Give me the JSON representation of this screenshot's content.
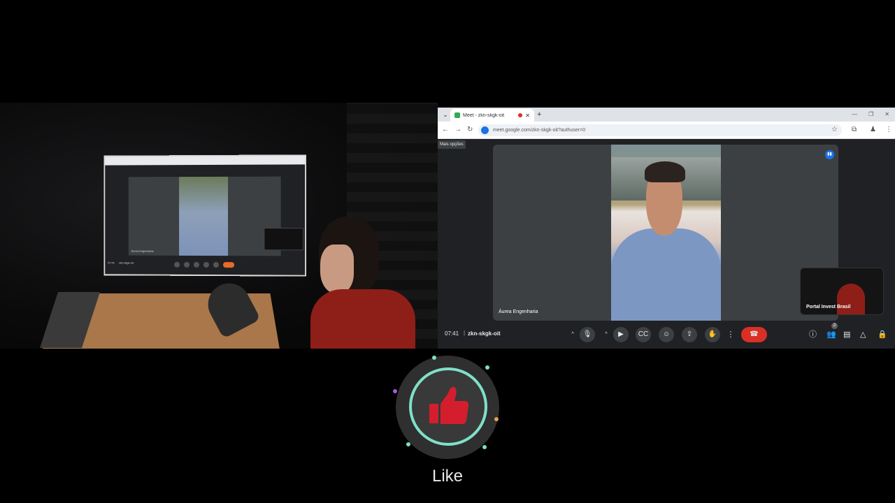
{
  "studio_monitor": {
    "screen_clock": "07:41",
    "screen_code": "zkn-skgk-oit",
    "screen_name": "Áurea Engenharia"
  },
  "browser": {
    "tab_title": "Meet - zkn-skgk-oit",
    "new_tab": "+",
    "address_url": "meet.google.com/zkn-skgk-oit?authuser=0"
  },
  "meet": {
    "more_options": "Mais opções",
    "main_participant": "Áurea Engenharia",
    "self_participant": "Portal Invest Brasil",
    "clock": "07:41",
    "meeting_code": "zkn-skgk-oit",
    "participants_count": "2"
  },
  "overlay": {
    "like_label": "Like"
  },
  "colors": {
    "meet_bg": "#202124",
    "tile_bg": "#3c4043",
    "end_call": "#d93025",
    "accent_blue": "#1a73e8",
    "like_ring": "#7fe0c8",
    "thumb": "#d41e2e"
  },
  "icons": {
    "tab_list": "chevron-down-icon",
    "back": "arrow-left-icon",
    "forward": "arrow-right-icon",
    "reload": "reload-icon",
    "bookmark": "star-icon",
    "mic": "microphone-icon",
    "camera": "video-camera-icon",
    "captions": "captions-icon",
    "emoji": "emoji-icon",
    "present": "present-screen-icon",
    "raise_hand": "hand-icon",
    "more": "more-vertical-icon",
    "end_call": "phone-hangup-icon",
    "info": "info-icon",
    "people": "people-icon",
    "chat": "chat-icon",
    "activities": "activities-icon",
    "host_controls": "lock-icon",
    "like": "thumbs-up-icon"
  }
}
